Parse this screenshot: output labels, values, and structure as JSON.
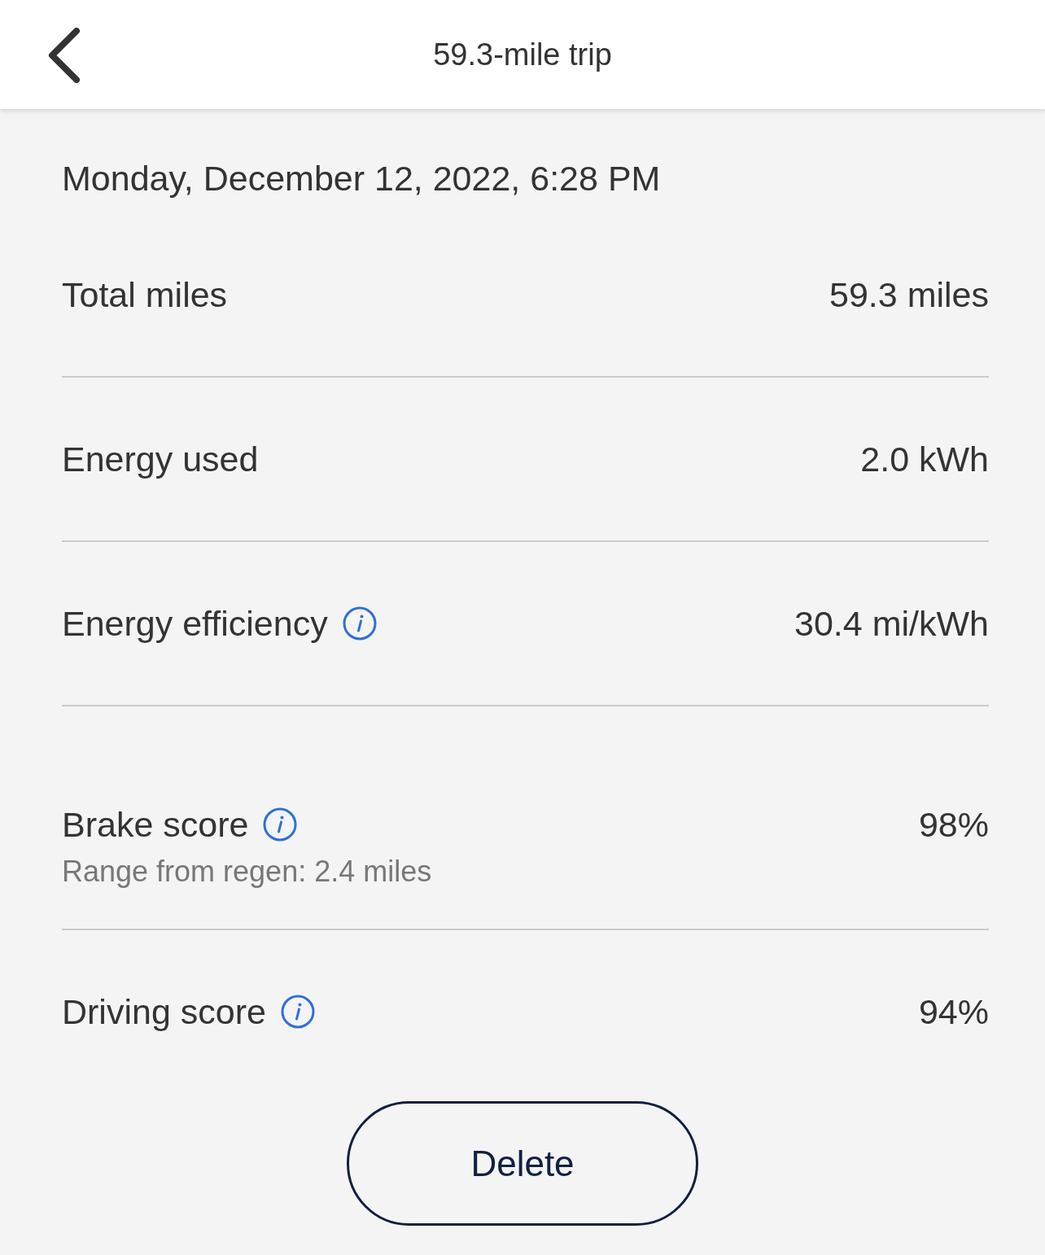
{
  "header": {
    "title": "59.3-mile trip"
  },
  "date": "Monday, December 12, 2022, 6:28 PM",
  "rows": [
    {
      "label": "Total miles",
      "value": "59.3 miles",
      "info": false
    },
    {
      "label": "Energy used",
      "value": "2.0 kWh",
      "info": false
    },
    {
      "label": "Energy efficiency",
      "value": "30.4 mi/kWh",
      "info": true
    },
    {
      "label": "Brake score",
      "value": "98%",
      "info": true,
      "sublabel": "Range from regen: 2.4 miles"
    },
    {
      "label": "Driving score",
      "value": "94%",
      "info": true
    }
  ],
  "button": {
    "label": "Delete"
  }
}
